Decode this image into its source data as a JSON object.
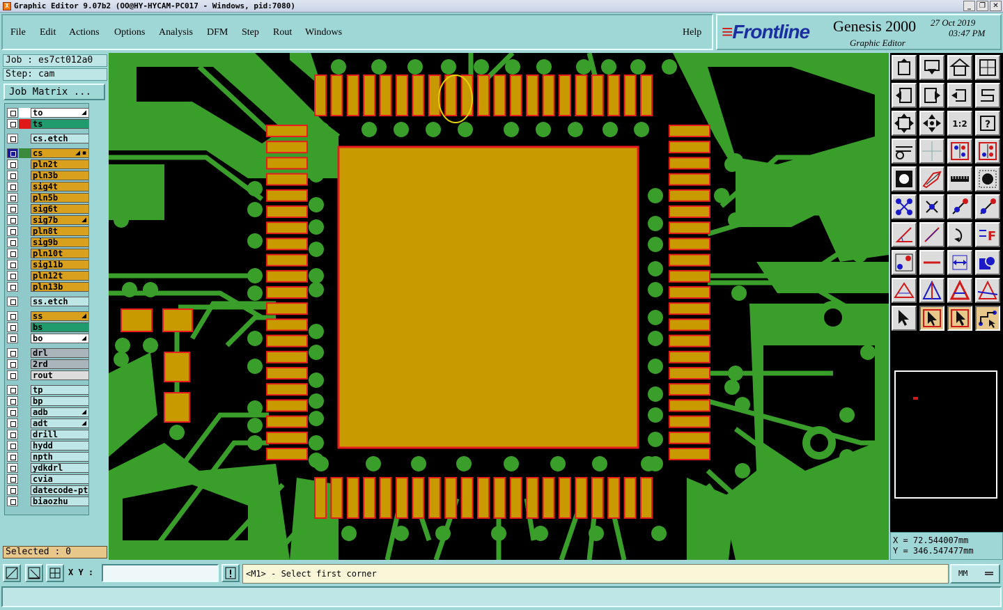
{
  "window": {
    "title": "Graphic Editor 9.07b2 (OO@HY-HYCAM-PC017 - Windows, pid:7080)",
    "buttons": [
      "_",
      "❐",
      "✕"
    ]
  },
  "menu": {
    "items": [
      "File",
      "Edit",
      "Actions",
      "Options",
      "Analysis",
      "DFM",
      "Step",
      "Rout",
      "Windows"
    ],
    "help": "Help"
  },
  "brand": {
    "logo": "Frontline",
    "product": "Genesis 2000",
    "subtitle": "Graphic Editor",
    "date": "27 Oct 2019",
    "time": "03:47 PM"
  },
  "job": {
    "job": "Job : es7ct012a0",
    "step": "Step: cam",
    "matrix_button": "Job Matrix ..."
  },
  "layers": [
    {
      "name": "to",
      "color": "#ffffff",
      "swatch": "#ffffff",
      "flag": "◢",
      "active": false,
      "group": 0
    },
    {
      "name": "ts",
      "color": "#1f9b6e",
      "swatch": "#e01818",
      "flag": "",
      "active": false,
      "group": 0
    },
    {
      "name": "cs.etch",
      "color": "#bfe6e6",
      "swatch": "",
      "flag": "",
      "active": false,
      "group": 1
    },
    {
      "name": "cs",
      "color": "#d8a01c",
      "swatch": "#3c8a3c",
      "flag": "◢ ▪",
      "active": true,
      "group": 2
    },
    {
      "name": "pln2t",
      "color": "#d8a01c",
      "swatch": "",
      "flag": "",
      "active": false,
      "group": 2
    },
    {
      "name": "pln3b",
      "color": "#d8a01c",
      "swatch": "",
      "flag": "",
      "active": false,
      "group": 2
    },
    {
      "name": "sig4t",
      "color": "#d8a01c",
      "swatch": "",
      "flag": "",
      "active": false,
      "group": 2
    },
    {
      "name": "pln5b",
      "color": "#d8a01c",
      "swatch": "",
      "flag": "",
      "active": false,
      "group": 2
    },
    {
      "name": "sig6t",
      "color": "#d8a01c",
      "swatch": "",
      "flag": "",
      "active": false,
      "group": 2
    },
    {
      "name": "sig7b",
      "color": "#d8a01c",
      "swatch": "",
      "flag": "◢",
      "active": false,
      "group": 2
    },
    {
      "name": "pln8t",
      "color": "#d8a01c",
      "swatch": "",
      "flag": "",
      "active": false,
      "group": 2
    },
    {
      "name": "sig9b",
      "color": "#d8a01c",
      "swatch": "",
      "flag": "",
      "active": false,
      "group": 2
    },
    {
      "name": "pln10t",
      "color": "#d8a01c",
      "swatch": "",
      "flag": "",
      "active": false,
      "group": 2
    },
    {
      "name": "sig11b",
      "color": "#d8a01c",
      "swatch": "",
      "flag": "",
      "active": false,
      "group": 2
    },
    {
      "name": "pln12t",
      "color": "#d8a01c",
      "swatch": "",
      "flag": "",
      "active": false,
      "group": 2
    },
    {
      "name": "pln13b",
      "color": "#d8a01c",
      "swatch": "",
      "flag": "",
      "active": false,
      "group": 2
    },
    {
      "name": "ss.etch",
      "color": "#bfe6e6",
      "swatch": "",
      "flag": "",
      "active": false,
      "group": 3
    },
    {
      "name": "ss",
      "color": "#d8a01c",
      "swatch": "",
      "flag": "◢",
      "active": false,
      "group": 4
    },
    {
      "name": "bs",
      "color": "#1f9b6e",
      "swatch": "",
      "flag": "",
      "active": false,
      "group": 4
    },
    {
      "name": "bo",
      "color": "#ffffff",
      "swatch": "",
      "flag": "◢",
      "active": false,
      "group": 4
    },
    {
      "name": "drl",
      "color": "#a9b4bb",
      "swatch": "",
      "flag": "",
      "active": false,
      "group": 5
    },
    {
      "name": "2rd",
      "color": "#a9b4bb",
      "swatch": "",
      "flag": "",
      "active": false,
      "group": 5
    },
    {
      "name": "rout",
      "color": "#dcdcdc",
      "swatch": "",
      "flag": "",
      "active": false,
      "group": 5
    },
    {
      "name": "tp",
      "color": "#bfe6e6",
      "swatch": "",
      "flag": "",
      "active": false,
      "group": 6
    },
    {
      "name": "bp",
      "color": "#bfe6e6",
      "swatch": "",
      "flag": "",
      "active": false,
      "group": 6
    },
    {
      "name": "adb",
      "color": "#bfe6e6",
      "swatch": "",
      "flag": "◢",
      "active": false,
      "group": 6
    },
    {
      "name": "adt",
      "color": "#bfe6e6",
      "swatch": "",
      "flag": "◢",
      "active": false,
      "group": 6
    },
    {
      "name": "drill",
      "color": "#bfe6e6",
      "swatch": "",
      "flag": "",
      "active": false,
      "group": 6
    },
    {
      "name": "hydd",
      "color": "#bfe6e6",
      "swatch": "",
      "flag": "",
      "active": false,
      "group": 6
    },
    {
      "name": "npth",
      "color": "#bfe6e6",
      "swatch": "",
      "flag": "",
      "active": false,
      "group": 6
    },
    {
      "name": "ydkdrl",
      "color": "#bfe6e6",
      "swatch": "",
      "flag": "",
      "active": false,
      "group": 6
    },
    {
      "name": "cvia",
      "color": "#bfe6e6",
      "swatch": "",
      "flag": "",
      "active": false,
      "group": 6
    },
    {
      "name": "datecode-pt",
      "color": "#bfe6e6",
      "swatch": "",
      "flag": "",
      "active": false,
      "group": 6
    },
    {
      "name": "biaozhu",
      "color": "#bfe6e6",
      "swatch": "",
      "flag": "",
      "active": false,
      "group": 6
    }
  ],
  "selected": "Selected : 0",
  "coords": {
    "x": "X = 72.544007mm",
    "y": "Y = 346.547477mm"
  },
  "status": {
    "xy_label": "X Y :",
    "xy_value": "",
    "prompt": "<M1> - Select first corner",
    "unit": "MM"
  },
  "colors": {
    "copper": "#c89a00",
    "pad_outline": "#e81c1c",
    "trace_green": "#3a9e2a",
    "highlight": "#e6d200",
    "background": "#000000",
    "ui": "#9fd6d6"
  },
  "tools": [
    [
      "zoom-home-icon",
      "zoom-in-icon",
      "zoom-page-icon",
      "zoom-window-icon"
    ],
    [
      "pan-left-icon",
      "pan-right-icon",
      "zoom-back-icon",
      "redraw-icon"
    ],
    [
      "fit-all-icon",
      "center-icon",
      "scale-1-2-icon",
      "help-icon"
    ],
    [
      "snap-icon",
      "grid-icon",
      "layer-compare-icon",
      "layer-compare-active-icon"
    ],
    [
      "fill-mode-icon",
      "outline-mode-icon",
      "ruler-icon",
      "pad-mode-icon"
    ],
    [
      "connect-icon",
      "cross-icon",
      "measure-icon",
      "measure-point-icon"
    ],
    [
      "angle-icon",
      "line-icon",
      "arc-icon",
      "text-f-icon"
    ],
    [
      "move-point-icon",
      "minus-icon",
      "dimension-icon",
      "shape-icon"
    ],
    [
      "triangle-icon",
      "triangle-edit-icon",
      "triangle-bold-icon",
      "triangle-cross-icon"
    ],
    [
      "pointer-icon",
      "pointer-select-icon",
      "pointer-active-icon",
      "route-icon"
    ]
  ]
}
